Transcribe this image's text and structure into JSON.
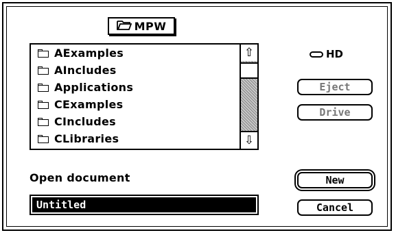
{
  "dialog": {
    "folder_popup": {
      "label": "MPW",
      "icon": "open-folder-icon"
    },
    "file_list": {
      "items": [
        {
          "label": "AExamples",
          "icon": "folder-icon"
        },
        {
          "label": "AIncludes",
          "icon": "folder-icon"
        },
        {
          "label": "Applications",
          "icon": "folder-icon"
        },
        {
          "label": "CExamples",
          "icon": "folder-icon"
        },
        {
          "label": "CIncludes",
          "icon": "folder-icon"
        },
        {
          "label": "CLibraries",
          "icon": "folder-icon"
        }
      ]
    },
    "disk": {
      "name": "HD",
      "icon": "hard-disk-icon"
    },
    "buttons": {
      "eject": {
        "label": "Eject",
        "enabled": false
      },
      "drive": {
        "label": "Drive",
        "enabled": false
      },
      "new": {
        "label": "New",
        "default": true
      },
      "cancel": {
        "label": "Cancel"
      }
    },
    "prompt": "Open document",
    "filename": {
      "value": "Untitled",
      "selected": true
    }
  }
}
